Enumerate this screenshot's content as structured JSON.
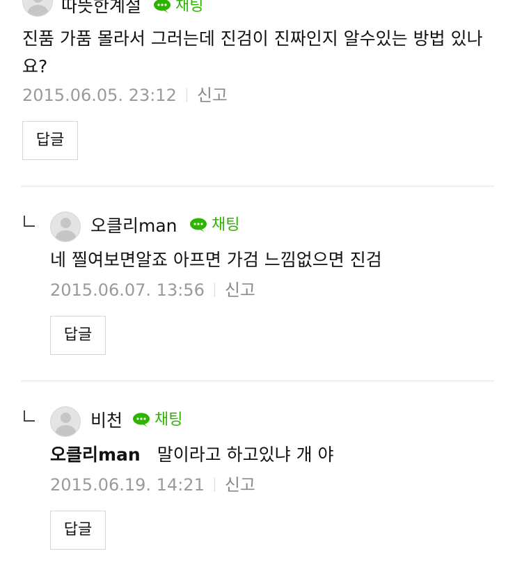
{
  "comments": [
    {
      "nickname": "따뜻한계절",
      "chat_label": "채팅",
      "text": "진품 가품 몰라서 그러는데 진검이 진짜인지 알수있는 방법 있나요?",
      "date": "2015.06.05. 23:12",
      "report_label": "신고",
      "reply_label": "답글"
    },
    {
      "nickname": "오클리man",
      "chat_label": "채팅",
      "text": "네 찔여보면알죠 아프면 가검 느낌없으면 진검",
      "date": "2015.06.07. 13:56",
      "report_label": "신고",
      "reply_label": "답글"
    },
    {
      "nickname": "비천",
      "chat_label": "채팅",
      "mention": "오클리man",
      "text": "말이라고 하고있냐 개 야",
      "date": "2015.06.19. 14:21",
      "report_label": "신고",
      "reply_label": "답글"
    }
  ],
  "colors": {
    "chat_green": "#2db400",
    "meta_gray": "#9a9a9a",
    "divider": "#e6e6e6"
  },
  "icons": {
    "avatar": "default-profile-icon",
    "chat": "speech-bubble-icon",
    "reply_marker": "reply-corner-icon"
  }
}
